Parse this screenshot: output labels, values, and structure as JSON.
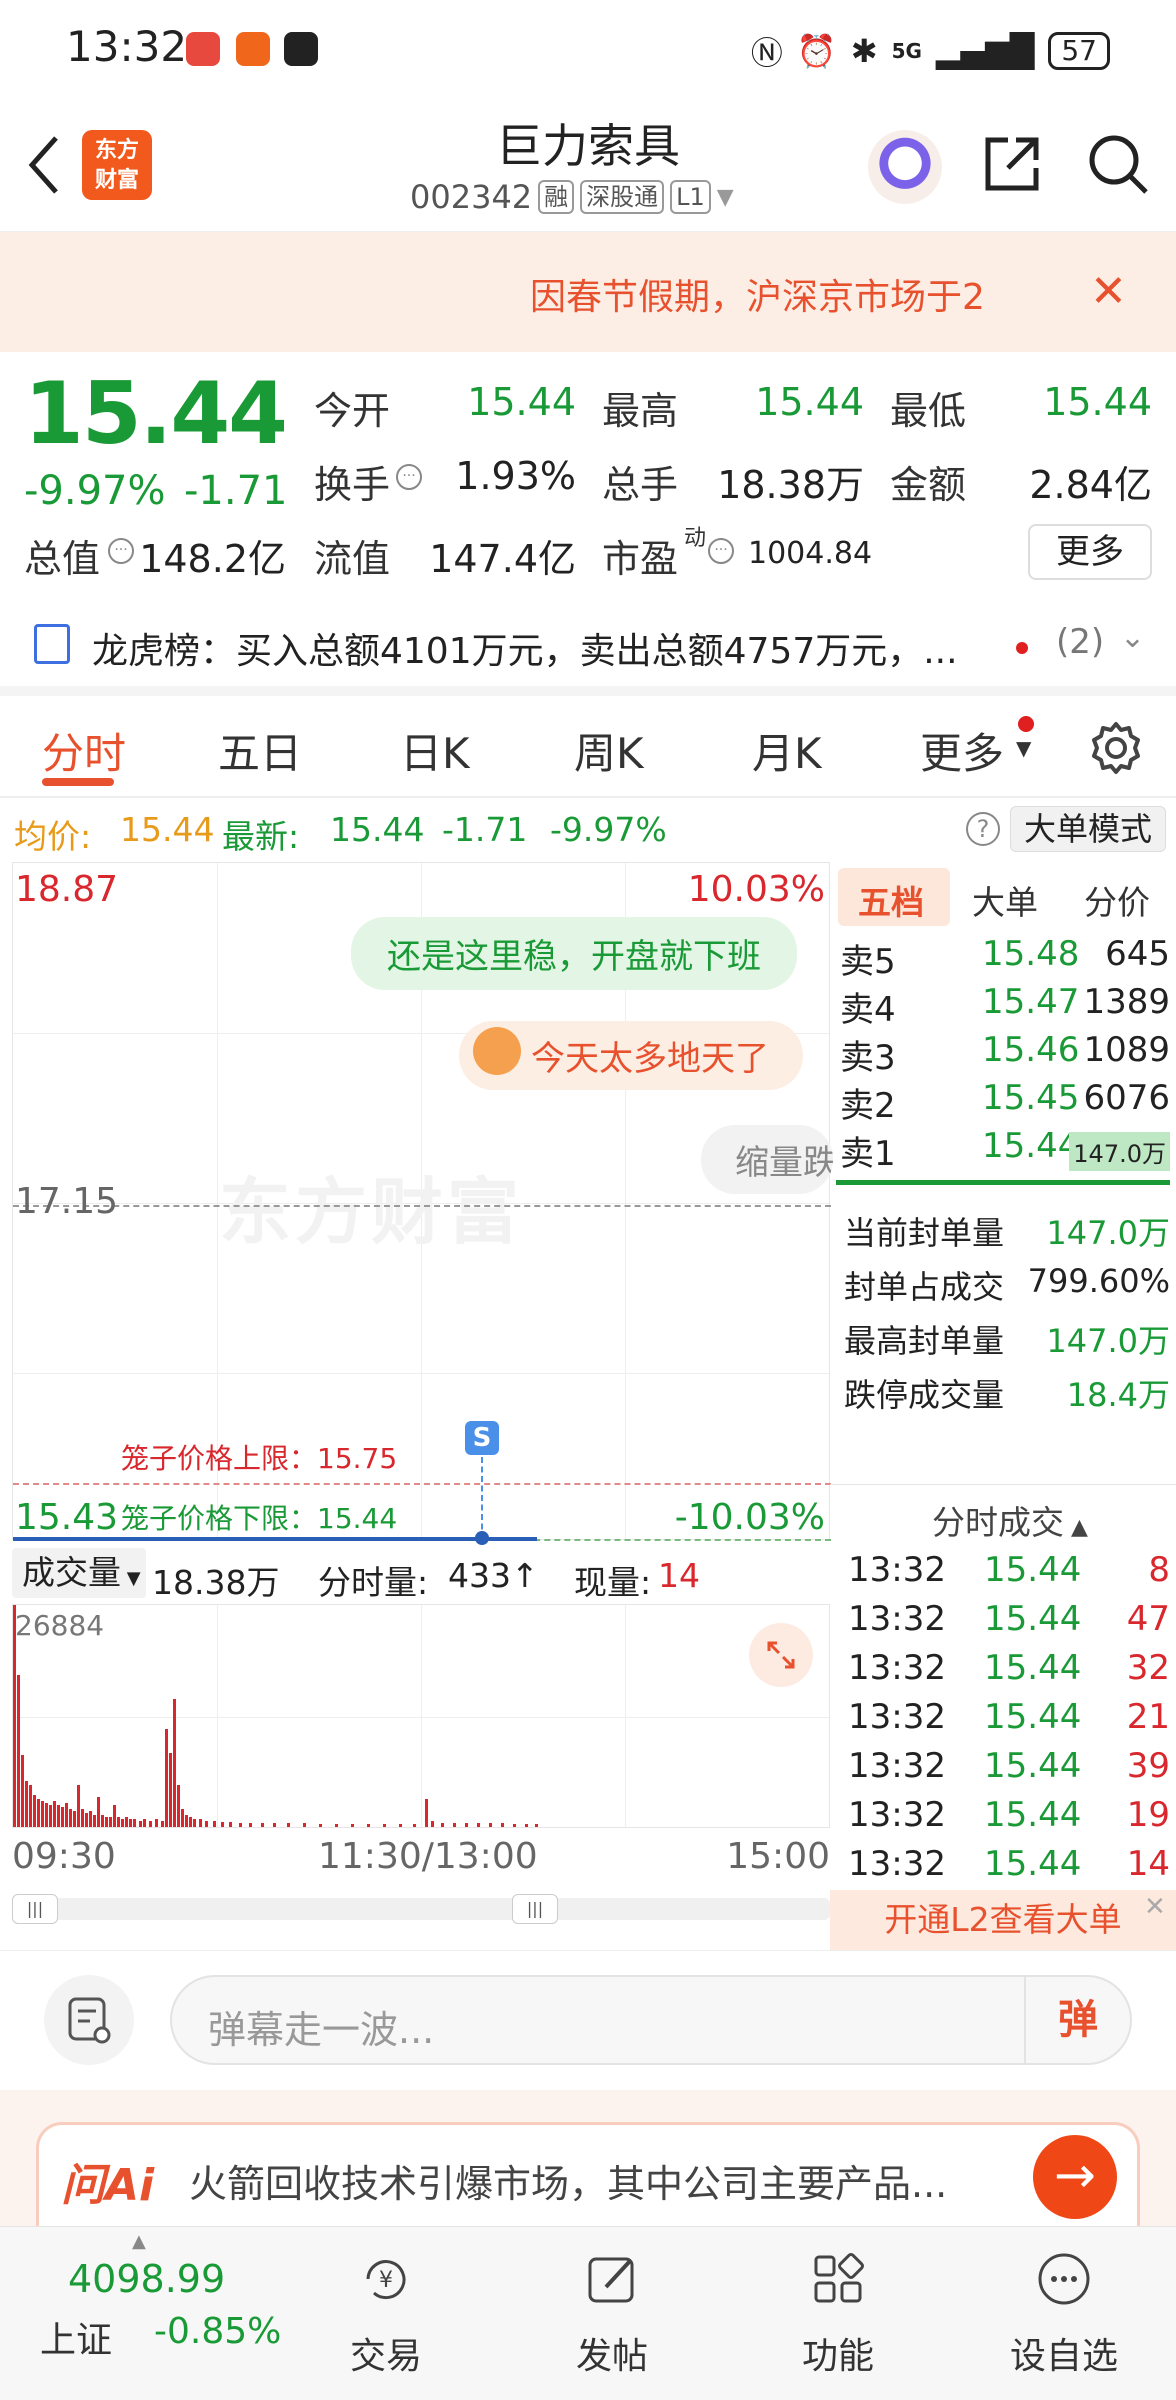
{
  "status_bar": {
    "time": "13:32",
    "battery": "57",
    "network": "5G"
  },
  "header": {
    "stock_name": "巨力索具",
    "stock_code": "002342",
    "tags": [
      "融",
      "深股通",
      "L1"
    ],
    "logo_line1": "东方",
    "logo_line2": "财富"
  },
  "notice": {
    "text": "因春节假期，沪深京市场于2",
    "close": "✕"
  },
  "quote": {
    "price": "15.44",
    "change_pct": "-9.97%",
    "change_val": "-1.71",
    "open_label": "今开",
    "open": "15.44",
    "high_label": "最高",
    "high": "15.44",
    "low_label": "最低",
    "low": "15.44",
    "turnover_label": "换手",
    "turnover": "1.93%",
    "volume_label": "总手",
    "volume": "18.38万",
    "amount_label": "金额",
    "amount": "2.84亿",
    "mktcap_label": "总值",
    "mktcap": "148.2亿",
    "float_label": "流值",
    "float": "147.4亿",
    "pe_label": "市盈",
    "pe_sup": "动",
    "pe": "1004.84",
    "more": "更多"
  },
  "dragon_tiger": {
    "text": "龙虎榜：买入总额4101万元，卖出总额4757万元，...",
    "count": "(2)"
  },
  "tabs": [
    "分时",
    "五日",
    "日K",
    "周K",
    "月K",
    "更多"
  ],
  "info_line": {
    "avg_label": "均价:",
    "avg": "15.44",
    "latest_label": "最新:",
    "latest": "15.44",
    "chg": "-1.71",
    "pct": "-9.97%",
    "help": "?",
    "big_mode": "大单模式"
  },
  "chart": {
    "top_price": "18.87",
    "top_pct": "10.03%",
    "mid_price": "17.15",
    "low_price": "15.43",
    "low_pct": "-10.03%",
    "cage_upper": "笼子价格上限：15.75",
    "cage_lower": "笼子价格下限：15.44",
    "marker": "S",
    "watermark": "东方财富",
    "bubbles": [
      "还是这里稳，开盘就下班",
      "今天太多地天了",
      "缩量跌"
    ]
  },
  "volume_bar": {
    "select_label": "成交量",
    "total": "18.38万",
    "minute_label": "分时量:",
    "minute": "433↑",
    "current_label": "现量:",
    "current": "14",
    "max": "26884"
  },
  "axis_times": [
    "09:30",
    "11:30/13:00",
    "15:00"
  ],
  "right_panel": {
    "tabs": [
      "五档",
      "大单",
      "分价"
    ],
    "order_book": [
      {
        "label": "卖5",
        "price": "15.48",
        "vol": "645"
      },
      {
        "label": "卖4",
        "price": "15.47",
        "vol": "1389"
      },
      {
        "label": "卖3",
        "price": "15.46",
        "vol": "1089"
      },
      {
        "label": "卖2",
        "price": "15.45",
        "vol": "6076"
      },
      {
        "label": "卖1",
        "price": "15.44",
        "vol": "147.0万"
      }
    ],
    "stats": [
      {
        "label": "当前封单量",
        "value": "147.0万"
      },
      {
        "label": "封单占成交",
        "value": "799.60%"
      },
      {
        "label": "最高封单量",
        "value": "147.0万"
      },
      {
        "label": "跌停成交量",
        "value": "18.4万"
      }
    ],
    "trades_title": "分时成交",
    "trades": [
      {
        "time": "13:32",
        "price": "15.44",
        "vol": "8"
      },
      {
        "time": "13:32",
        "price": "15.44",
        "vol": "47"
      },
      {
        "time": "13:32",
        "price": "15.44",
        "vol": "32"
      },
      {
        "time": "13:32",
        "price": "15.44",
        "vol": "21"
      },
      {
        "time": "13:32",
        "price": "15.44",
        "vol": "39"
      },
      {
        "time": "13:32",
        "price": "15.44",
        "vol": "19"
      },
      {
        "time": "13:32",
        "price": "15.44",
        "vol": "14"
      }
    ],
    "l2_banner": "开通L2查看大单"
  },
  "comment": {
    "placeholder": "弹幕走一波...",
    "danmu": "弹"
  },
  "ai": {
    "logo": "问Ai",
    "text": "火箭回收技术引爆市场，其中公司主要产品..."
  },
  "bottom_nav": {
    "index_val": "4098.99",
    "index_name": "上证",
    "index_chg": "-0.85%",
    "items": [
      "交易",
      "发帖",
      "功能",
      "设自选"
    ]
  },
  "colors": {
    "up": "#d9272e",
    "down": "#1a9a37",
    "accent": "#e8512e"
  }
}
